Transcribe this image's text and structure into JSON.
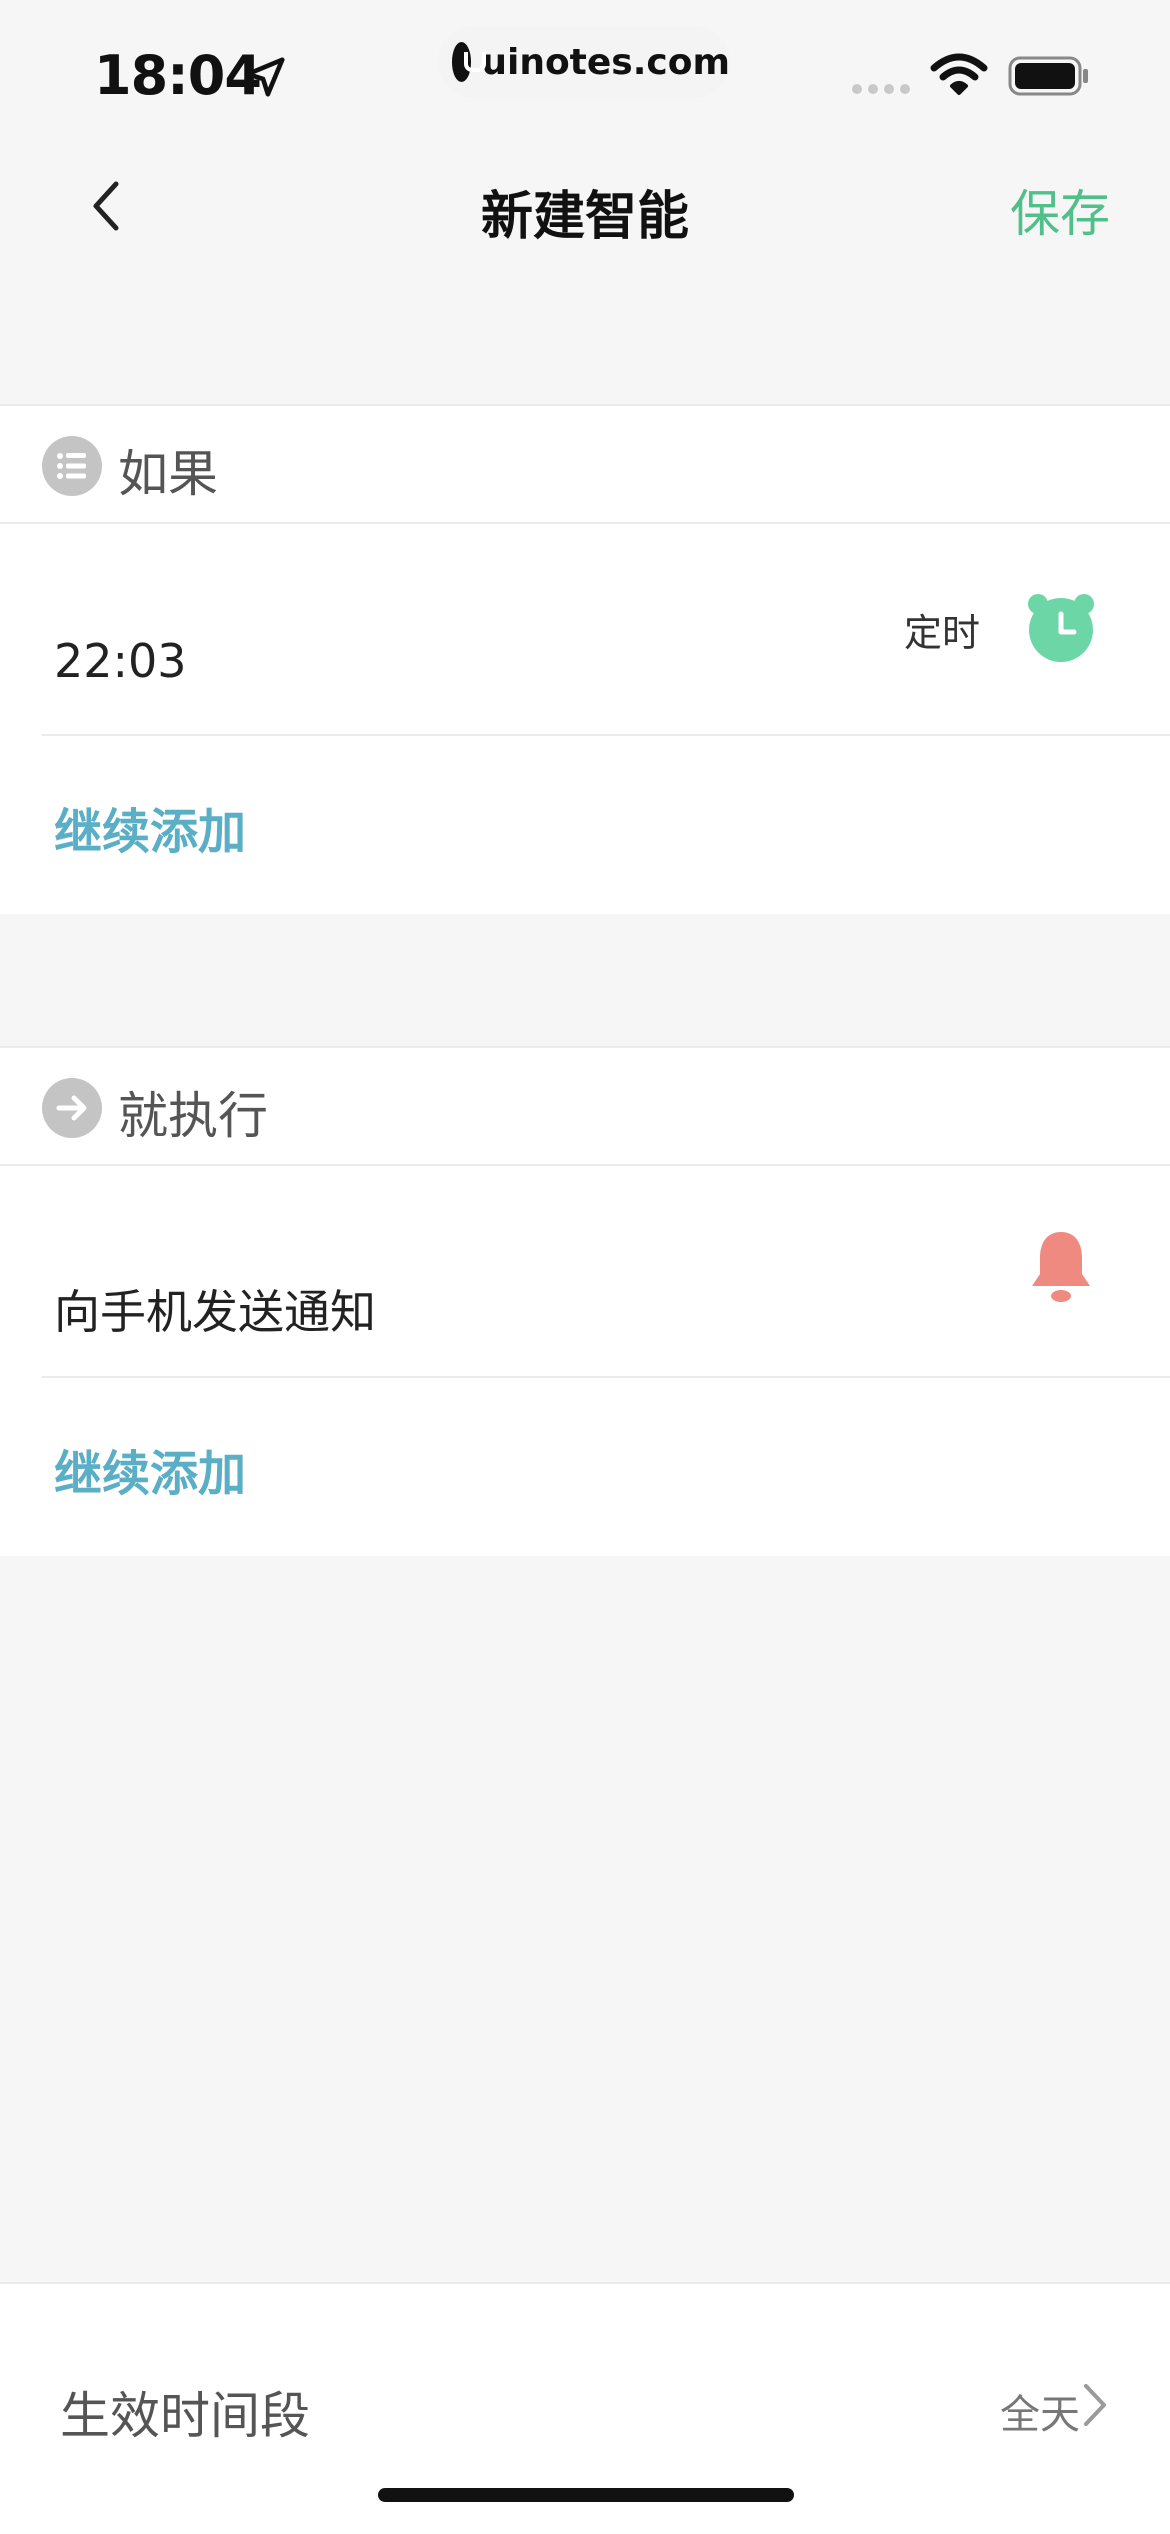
{
  "status_bar": {
    "time": "18:04",
    "url": "uinotes.com",
    "location_icon": "location-arrow-icon",
    "wifi_icon": "wifi-icon",
    "battery_icon": "battery-icon"
  },
  "nav": {
    "back_icon": "chevron-left-icon",
    "title": "新建智能",
    "save_label": "保存"
  },
  "if_section": {
    "label": "如果",
    "icon": "list-icon",
    "condition": {
      "value": "22:03",
      "type_label": "定时",
      "icon": "alarm-clock-icon"
    },
    "add_label": "继续添加"
  },
  "then_section": {
    "label": "就执行",
    "icon": "arrow-right-icon",
    "action": {
      "value": "向手机发送通知",
      "icon": "bell-icon"
    },
    "add_label": "继续添加"
  },
  "bottom": {
    "label": "生效时间段",
    "value": "全天",
    "chevron_icon": "chevron-right-icon"
  },
  "colors": {
    "accent_green": "#4fc08a",
    "link_blue": "#5aaec6",
    "alarm_green": "#6dd6a6",
    "bell_red": "#ee8a80"
  }
}
